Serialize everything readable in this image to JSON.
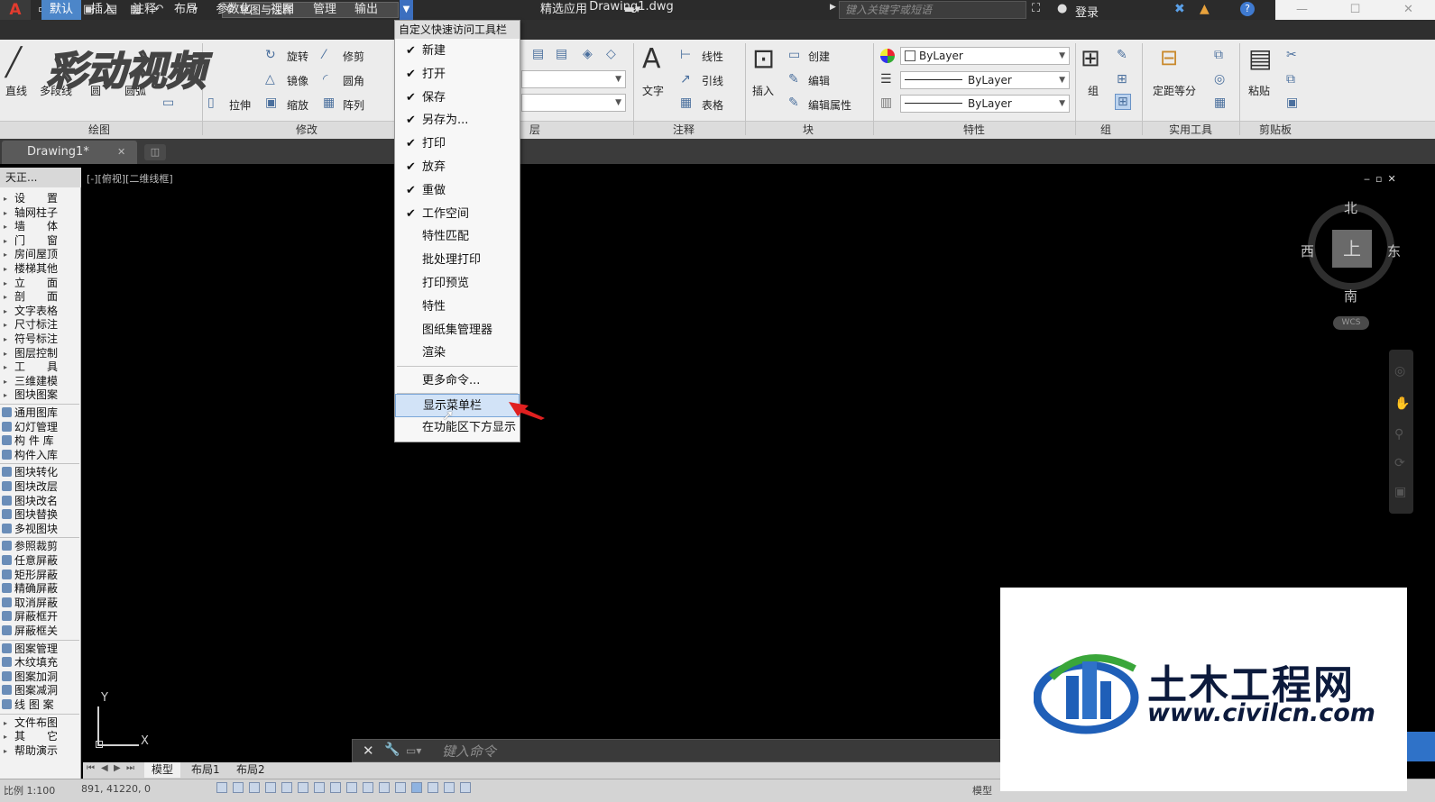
{
  "app": {
    "logo_letter": "A",
    "workspace": "草图与注释",
    "document_title": "Drawing1.dwg",
    "search_placeholder": "键入关键字或短语",
    "login_label": "登录",
    "help_label": "?"
  },
  "ribbon": {
    "tabs": [
      "默认",
      "插入",
      "注释",
      "布局",
      "参数化",
      "视图",
      "管理",
      "输出",
      "精选应用"
    ],
    "draw_panel": {
      "line": "直线",
      "polyline": "多段线",
      "circle": "圆",
      "arc": "圆弧",
      "footer": "绘图"
    },
    "modify_panel": {
      "rotate": "旋转",
      "trim": "修剪",
      "mirror": "镜像",
      "fillet": "圆角",
      "stretch": "拉伸",
      "scale": "缩放",
      "array": "阵列",
      "footer": "修改"
    },
    "layer_footer_tail": "层",
    "annotation_panel": {
      "text": "文字",
      "linear": "线性",
      "leader": "引线",
      "table": "表格",
      "footer": "注释"
    },
    "block_panel": {
      "insert": "插入",
      "create": "创建",
      "edit": "编辑",
      "edit_attr": "编辑属性",
      "footer": "块"
    },
    "properties_panel": {
      "color": "ByLayer",
      "linetype": "ByLayer",
      "lineweight": "ByLayer",
      "footer": "特性"
    },
    "group_panel": {
      "group": "组",
      "footer": "组"
    },
    "utilities_panel": {
      "measure": "定距等分",
      "footer": "实用工具"
    },
    "clipboard_panel": {
      "paste": "粘贴",
      "footer": "剪贴板"
    }
  },
  "watermark_top": {
    "text": "彩动视频"
  },
  "doc_tabs": {
    "active": "Drawing1*"
  },
  "palette": {
    "title": "天正...",
    "groups": [
      [
        "设　　置",
        "轴网柱子",
        "墙　　体",
        "门　　窗",
        "房间屋顶",
        "楼梯其他",
        "立　　面",
        "剖　　面",
        "文字表格",
        "尺寸标注",
        "符号标注",
        "图层控制",
        "工　　具",
        "三维建模",
        "图块图案"
      ],
      [
        "通用图库",
        "幻灯管理",
        "构 件 库",
        "构件入库"
      ],
      [
        "图块转化",
        "图块改层",
        "图块改名",
        "图块替换",
        "多视图块"
      ],
      [
        "参照裁剪",
        "任意屏蔽",
        "矩形屏蔽",
        "精确屏蔽",
        "取消屏蔽",
        "屏蔽框开",
        "屏蔽框关"
      ],
      [
        "图案管理",
        "木纹填充",
        "图案加洞",
        "图案减洞",
        "线 图 案"
      ],
      [
        "文件布图",
        "其　　它",
        "帮助演示"
      ]
    ]
  },
  "canvas": {
    "view_label": "[-][俯视][二维线框]",
    "viewcube": {
      "face": "上",
      "north": "北",
      "south": "南",
      "east": "东",
      "west": "西",
      "wcs": "WCS"
    },
    "ucs": {
      "x": "X",
      "y": "Y"
    }
  },
  "command_line": {
    "placeholder": "键入命令"
  },
  "layout_tabs": [
    "模型",
    "布局1",
    "布局2"
  ],
  "statusbar": {
    "scale": "比例 1:100",
    "coords": "891,  41220,  0",
    "model": "模型"
  },
  "qat_menu": {
    "header": "自定义快速访问工具栏",
    "checked_items": [
      "新建",
      "打开",
      "保存",
      "另存为...",
      "打印",
      "放弃",
      "重做",
      "工作空间"
    ],
    "unchecked_items": [
      "特性匹配",
      "批处理打印",
      "打印预览",
      "特性",
      "图纸集管理器",
      "渲染"
    ],
    "more_commands": "更多命令...",
    "show_menubar": "显示菜单栏",
    "show_below_ribbon": "在功能区下方显示"
  },
  "watermark": {
    "title": "土木工程网",
    "url": "www.civilcn.com"
  },
  "colors": {
    "accent": "#4c86c9",
    "canvas": "#000000",
    "menu_highlight": "#d2e3f7",
    "arrow": "#e02020"
  }
}
